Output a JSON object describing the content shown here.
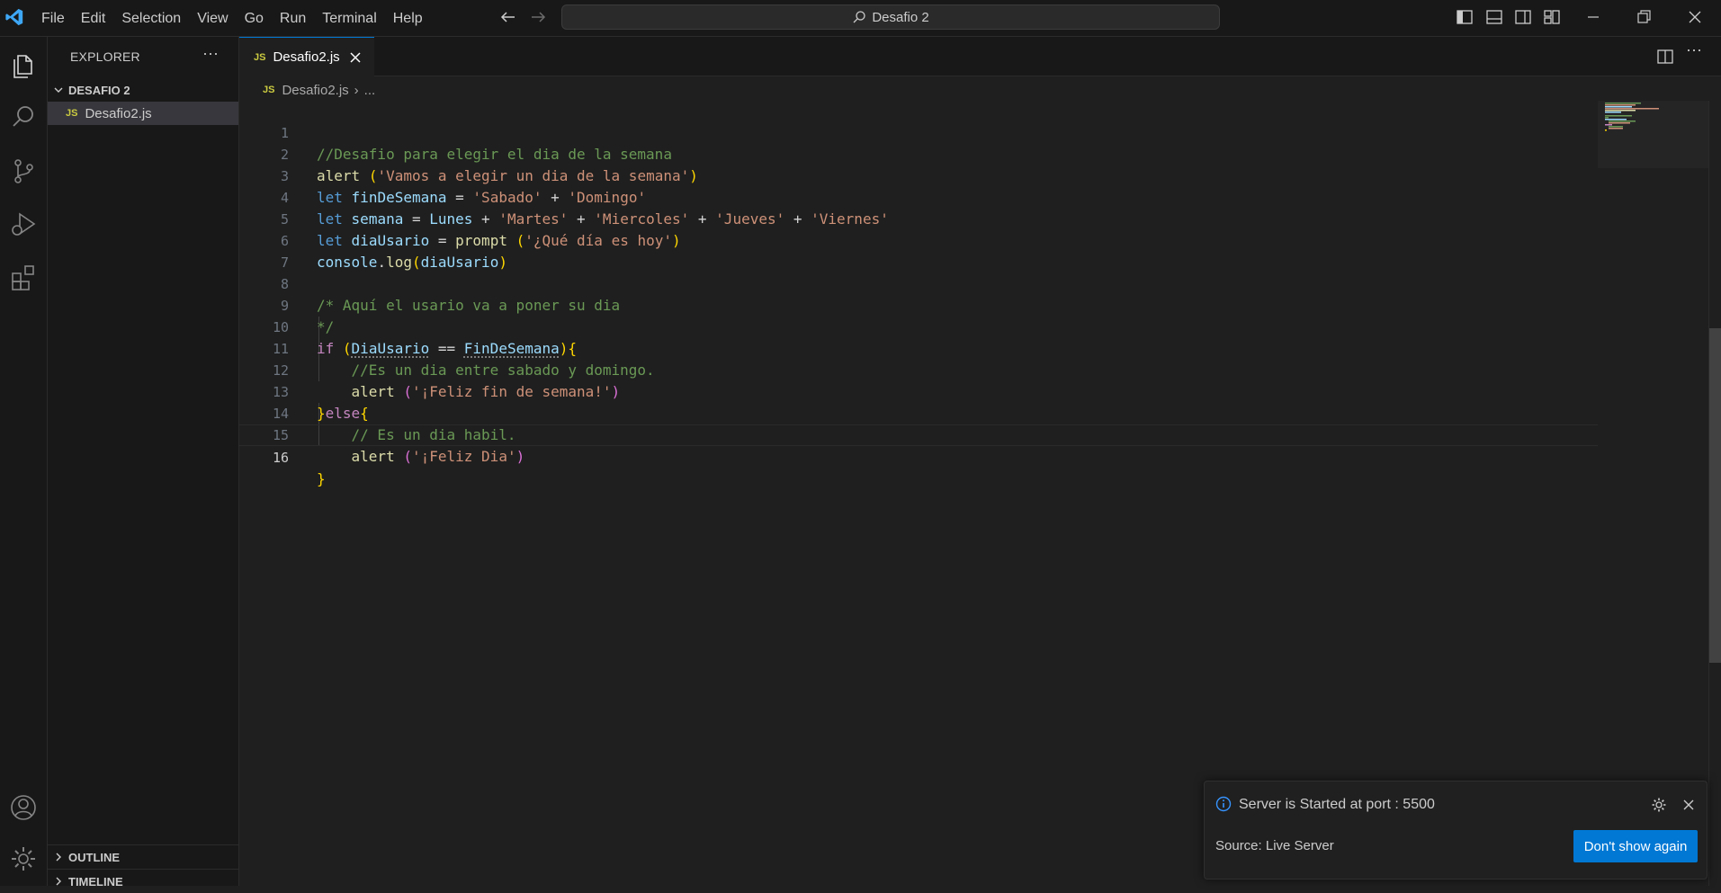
{
  "menu": [
    "File",
    "Edit",
    "Selection",
    "View",
    "Go",
    "Run",
    "Terminal",
    "Help"
  ],
  "command_center": {
    "label": "Desafio 2"
  },
  "sidebar": {
    "title": "EXPLORER",
    "more": "···",
    "folder": "DESAFIO 2",
    "file": {
      "badge": "JS",
      "name": "Desafio2.js"
    },
    "sections": [
      "OUTLINE",
      "TIMELINE"
    ]
  },
  "tab": {
    "badge": "JS",
    "name": "Desafio2.js"
  },
  "breadcrumb": {
    "badge": "JS",
    "file": "Desafio2.js",
    "sep": "›",
    "more": "..."
  },
  "editor": {
    "line_numbers": [
      "1",
      "2",
      "3",
      "4",
      "5",
      "6",
      "7",
      "8",
      "9",
      "10",
      "11",
      "12",
      "13",
      "14",
      "15",
      "16"
    ],
    "active_line": "16"
  },
  "notification": {
    "message": "Server is Started at port : 5500",
    "source": "Source: Live Server",
    "button": "Don't show again"
  },
  "colors": {
    "accent": "#0078d4",
    "js_badge": "#cbcb41",
    "comment": "#6a9955",
    "string": "#ce9178",
    "keyword": "#569cd6",
    "variable": "#9cdcfe",
    "function": "#dcdcaa"
  }
}
